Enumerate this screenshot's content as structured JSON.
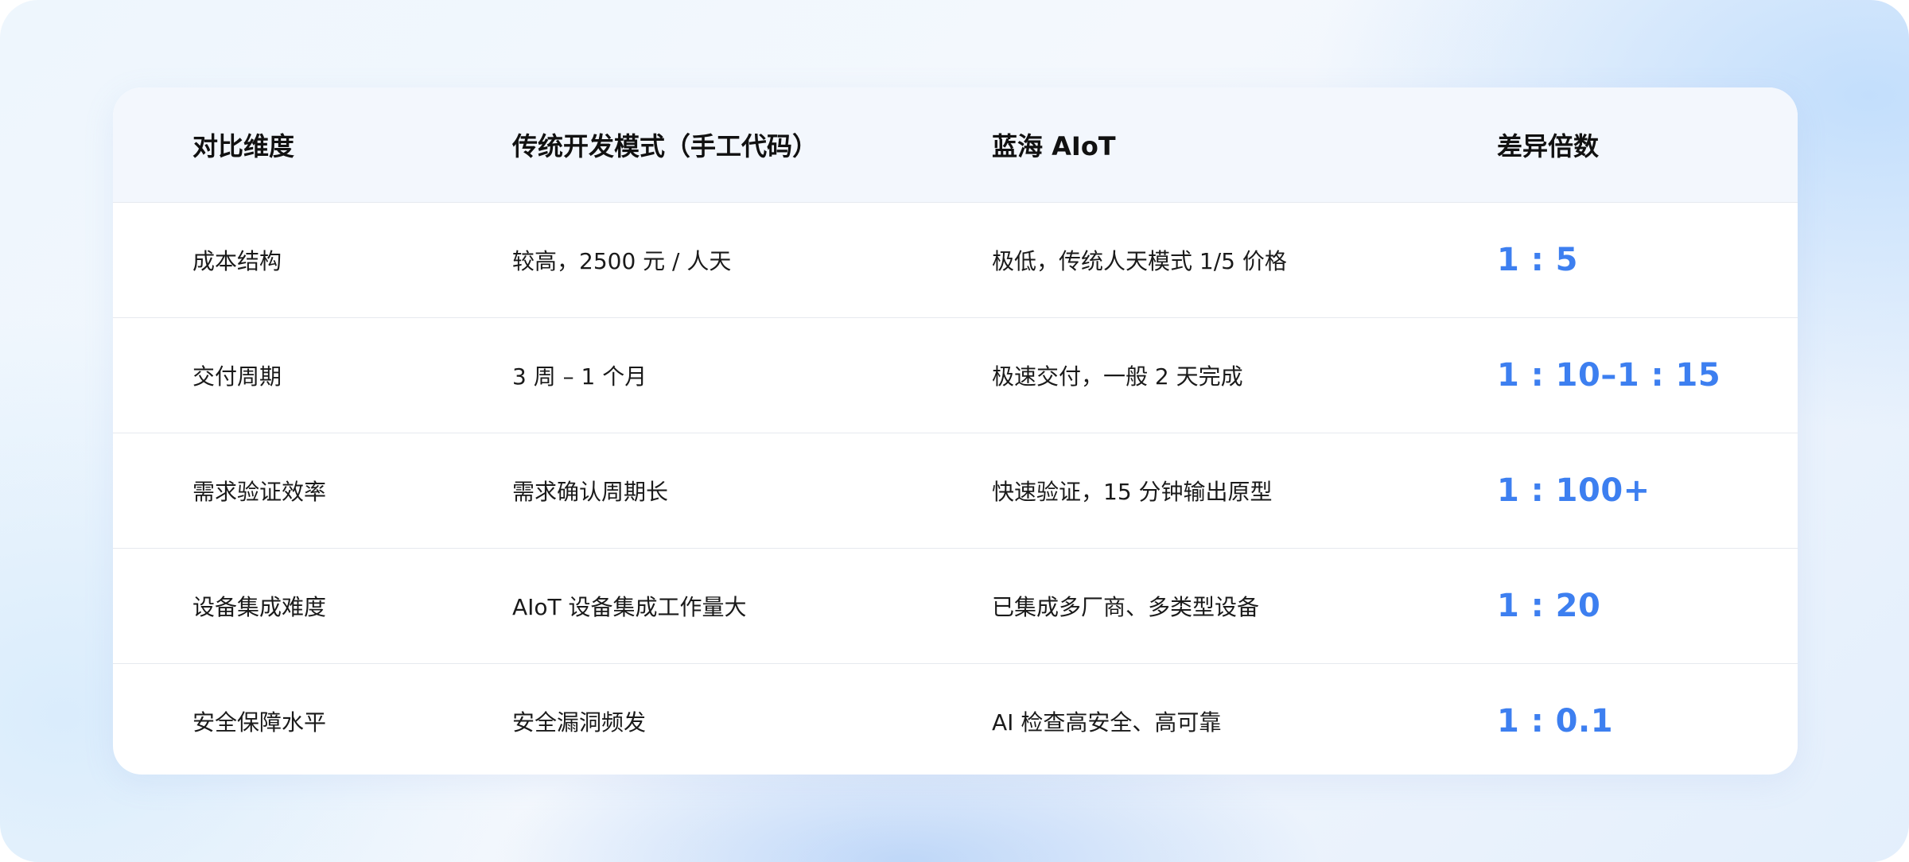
{
  "table": {
    "headers": [
      "对比维度",
      "传统开发模式（手工代码）",
      "蓝海 AIoT",
      "差异倍数"
    ],
    "rows": [
      [
        "成本结构",
        "较高，2500 元 / 人天",
        "极低，传统人天模式 1/5 价格",
        "1 : 5"
      ],
      [
        "交付周期",
        "3 周 – 1 个月",
        "极速交付，一般 2 天完成",
        "1 : 10–1 : 15"
      ],
      [
        "需求验证效率",
        "需求确认周期长",
        "快速验证，15 分钟输出原型",
        "1 : 100+"
      ],
      [
        "设备集成难度",
        "AIoT 设备集成工作量大",
        "已集成多厂商、多类型设备",
        "1 : 20"
      ],
      [
        "安全保障水平",
        "安全漏洞频发",
        "AI 检查高安全、高可靠",
        "1 : 0.1"
      ]
    ]
  },
  "colors": {
    "accent": "#3d7ff0",
    "header_bg": "#f3f7fd"
  }
}
